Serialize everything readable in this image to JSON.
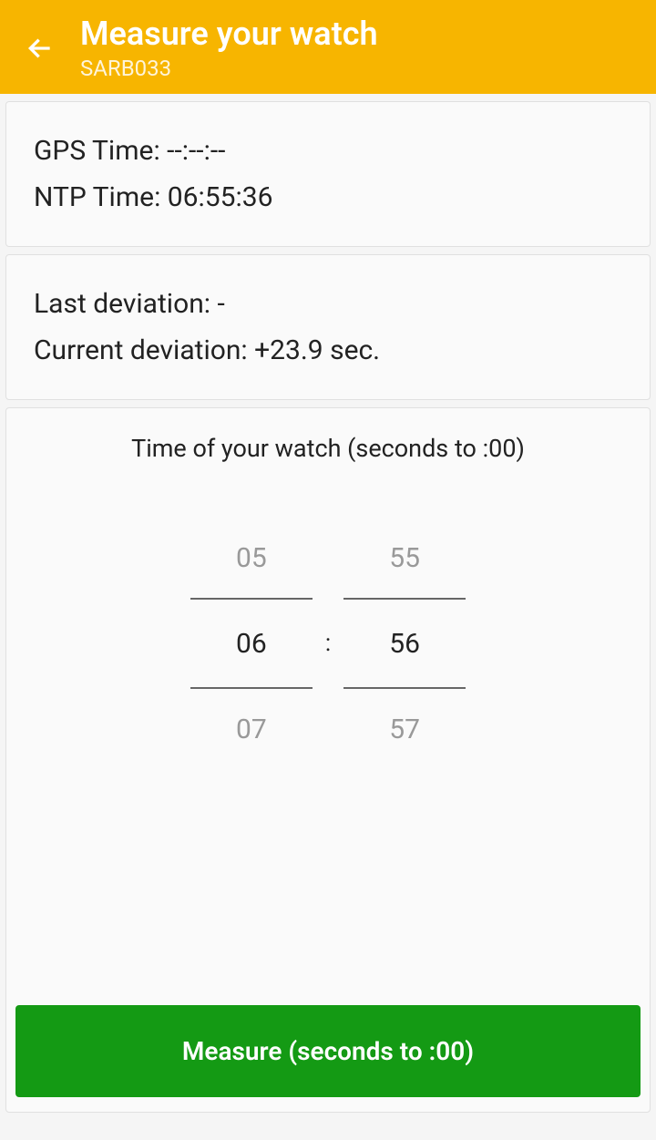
{
  "header": {
    "title": "Measure your watch",
    "subtitle": "SARB033"
  },
  "time_card": {
    "gps_label": "GPS Time: ",
    "gps_value": "--:--:--",
    "ntp_label": "NTP Time: ",
    "ntp_value": "06:55:36"
  },
  "deviation_card": {
    "last_label": "Last deviation: ",
    "last_value": "-",
    "current_label": "Current deviation: ",
    "current_value": "+23.9 sec."
  },
  "picker": {
    "title": "Time of your watch (seconds to :00)",
    "hours_prev": "05",
    "hours_current": "06",
    "hours_next": "07",
    "minutes_prev": "55",
    "minutes_current": "56",
    "minutes_next": "57",
    "colon": ":"
  },
  "button": {
    "measure_label": "Measure (seconds to :00)"
  }
}
